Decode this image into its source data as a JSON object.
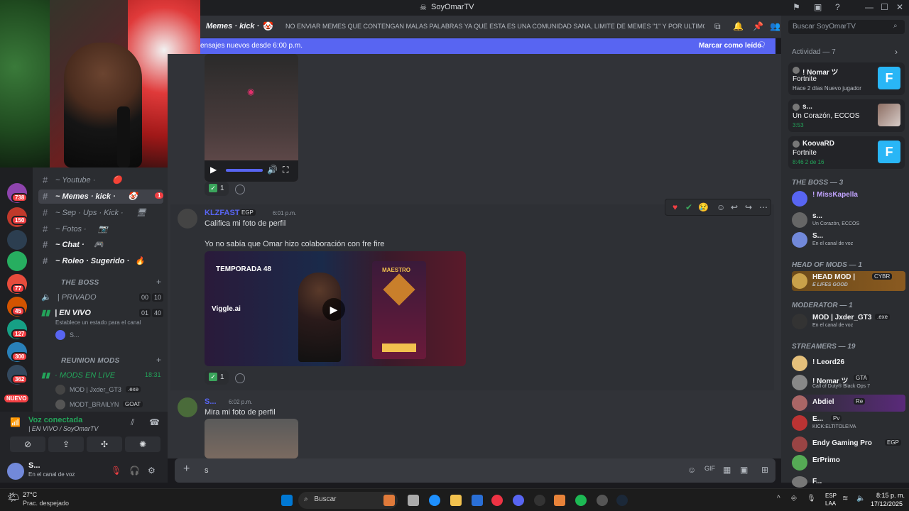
{
  "window": {
    "title": "SoyOmarTV"
  },
  "channels": [
    {
      "label": "~ Youtube ·",
      "emoji": "🔴"
    },
    {
      "label": "~ Memes · kick ·",
      "emoji": "🤡",
      "selected": true,
      "badge": "1"
    },
    {
      "label": "~ Sep · Ups · Kick ·",
      "emoji": "🖥"
    },
    {
      "label": "~ Fotos ·",
      "emoji": "📷"
    },
    {
      "label": "~ Chat ·",
      "emoji": "🎮"
    },
    {
      "label": "~ Roleo · Sugerido ·",
      "emoji": "🔥"
    }
  ],
  "categories": {
    "boss": "THE BOSS",
    "reunion": "REUNION MODS"
  },
  "voice_channels": {
    "privado": {
      "label": "| PRIVADO",
      "counts": [
        "00",
        "10"
      ]
    },
    "envivo": {
      "label": "| EN VIVO",
      "counts": [
        "01",
        "40"
      ],
      "status": "Establece un estado para el canal",
      "user": "S..."
    },
    "mods": {
      "label": "· MODS EN LIVE",
      "time": "18:31"
    },
    "mods_users": [
      {
        "name": "MOD | Jxder_GT3",
        "tag": ".exe"
      },
      {
        "name": "MODT_BRAILYN",
        "tag": "GOAT"
      }
    ]
  },
  "server_badges": [
    "738",
    "150",
    "77",
    "45",
    "127",
    "300",
    "362"
  ],
  "server_new": "NUEVO",
  "voice_panel": {
    "status": "Voz conectada",
    "sub": "| EN VIVO / SoyOmarTV",
    "user": "S...",
    "user_status": "En el canal de voz"
  },
  "chat": {
    "channel": "Memes · kick ·",
    "topic": "NO ENVIAR MEMES QUE CONTENGAN MALAS PALABRAS YA QUE ESTA ES UNA COMUNIDAD SANA, LIMITE DE MEMES \"1\" Y POR ULTIMO EL ...",
    "new_bar": "ensajes nuevos desde 6:00 p.m.",
    "mark_read": "Marcar como leído",
    "reaction_count": "1",
    "messages": [
      {
        "author": "KLZFAST",
        "tag": "EGP",
        "time": "6:01 p.m.",
        "text1": "Califica mi foto de perfil",
        "text2": "Yo no sabía que Omar hizo colaboración con fre fire"
      },
      {
        "author": "S...",
        "time": "6:02 p.m.",
        "text1": "Mira mi foto de perfil"
      }
    ],
    "game_card": {
      "season": "TEMPORADA 48",
      "rank": "MAESTRO",
      "watermark": "Viggle.ai"
    },
    "composer_text": "s"
  },
  "members": {
    "search_placeholder": "Buscar SoyOmarTV",
    "activity_header": "Actividad — 7",
    "activity": [
      {
        "name": "! Nomar ツ",
        "game": "Fortnite",
        "sub": "Hace 2 días  Nuevo jugador",
        "thumb": "F",
        "color": "#29b6f6"
      },
      {
        "name": "s...",
        "game": "Un Corazón, ECCOS",
        "sub": "3:53",
        "thumb": "",
        "color": "#8d6e63"
      },
      {
        "name": "KoovaRD",
        "game": "Fortnite",
        "sub": "8:46  2 de 16",
        "thumb": "F",
        "color": "#29b6f6"
      }
    ],
    "groups": [
      {
        "title": "THE BOSS — 3",
        "members": [
          {
            "name": "! MissKapella",
            "sub": "",
            "color": "#c2a4ff"
          },
          {
            "name": "s...",
            "sub": "Un Corazón, ECCOS",
            "color": "#f2f3f5"
          },
          {
            "name": "S...",
            "sub": "En el canal de voz",
            "color": "#f2f3f5"
          }
        ]
      },
      {
        "title": "HEAD OF MODS — 1",
        "members": [
          {
            "name": "HEAD MOD |",
            "tag": "CYBR",
            "sub": "E LIFES GOOD",
            "color": "#f2f3f5",
            "highlight": true
          }
        ]
      },
      {
        "title": "MODERATOR — 1",
        "members": [
          {
            "name": "MOD | Jxder_GT3",
            "tag": ".exe",
            "sub": "En el canal de voz",
            "color": "#f2f3f5"
          }
        ]
      },
      {
        "title": "STREAMERS — 19",
        "members": [
          {
            "name": "! Leord26",
            "sub": "",
            "color": "#f2f3f5"
          },
          {
            "name": "! Nomar ツ",
            "tag": "GTA",
            "sub": "Call of Duty® Black Ops 7",
            "color": "#f2f3f5"
          },
          {
            "name": "Abdiel",
            "tag": "Re",
            "sub": "",
            "color": "#f2f3f5",
            "highlight2": true
          },
          {
            "name": "E...",
            "tag": "Pv",
            "sub": "KICK:ELTITOLEIVA",
            "color": "#f2f3f5"
          },
          {
            "name": "Endy Gaming Pro",
            "tag": "EGP",
            "sub": "",
            "color": "#f2f3f5"
          },
          {
            "name": "ErPrimo",
            "sub": "",
            "color": "#f2f3f5"
          },
          {
            "name": "F...",
            "sub": "",
            "color": "#f2f3f5"
          }
        ]
      }
    ]
  },
  "taskbar": {
    "weather_temp": "27°C",
    "weather_desc": "Prac. despejado",
    "search": "Buscar",
    "lang": "ESP",
    "lang2": "LAA",
    "time": "8:15 p. m.",
    "date": "17/12/2025"
  }
}
